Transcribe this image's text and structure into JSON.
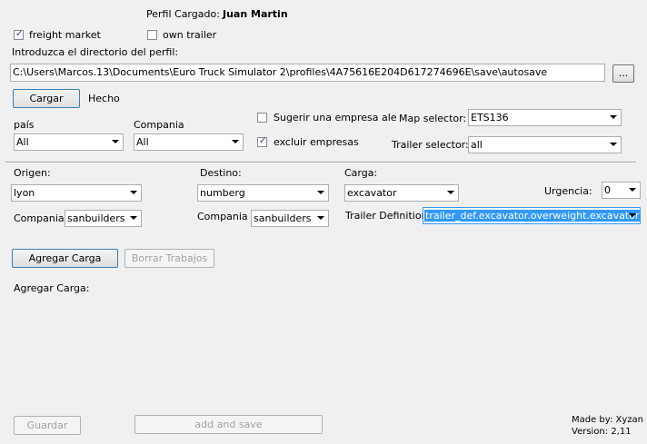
{
  "profile": {
    "loaded_label": "Perfil Cargado:",
    "loaded_name": "Juan Martin"
  },
  "options": {
    "freight_market_label": "freight market",
    "freight_market_checked": true,
    "own_trailer_label": "own trailer",
    "own_trailer_checked": false
  },
  "path": {
    "label": "Introduzca el directorio del perfil:",
    "value": "C:\\Users\\Marcos.13\\Documents\\Euro Truck Simulator 2\\profiles\\4A75616E204D617274696E\\save\\autosave",
    "browse_label": "..."
  },
  "load": {
    "button_label": "Cargar",
    "status": "Hecho"
  },
  "filters": {
    "pais_label": "país",
    "pais_value": "All",
    "compania_label": "Compania",
    "compania_value": "All",
    "random_company_label": "Sugerir una empresa aleatoria",
    "random_company_checked": false,
    "exclude_companies_label": "excluir empresas",
    "exclude_companies_checked": true,
    "map_selector_label": "Map selector:",
    "map_selector_value": "ETS136",
    "trailer_selector_label": "Trailer selector:",
    "trailer_selector_value": "all"
  },
  "job": {
    "origin_label": "Origen:",
    "origin_value": "lyon",
    "origin_company_label": "Compania",
    "origin_company_value": "sanbuilders",
    "destination_label": "Destino:",
    "destination_value": "numberg",
    "destination_company_label": "Compania",
    "destination_company_value": "sanbuilders",
    "cargo_label": "Carga:",
    "cargo_value": "excavator",
    "urgency_label": "Urgencia:",
    "urgency_value": "0",
    "trailer_def_label": "Trailer Definition",
    "trailer_def_value": "trailer_def.excavator.overweight.excavator"
  },
  "actions": {
    "add_cargo_label": "Agregar Carga",
    "clear_jobs_label": "Borrar Trabajos",
    "add_cargo_list_label": "Agregar Carga:",
    "save_label": "Guardar",
    "add_and_save_label": "add and save"
  },
  "footer": {
    "made_by": "Made by: Xyzan",
    "version": "Version: 2,11"
  }
}
